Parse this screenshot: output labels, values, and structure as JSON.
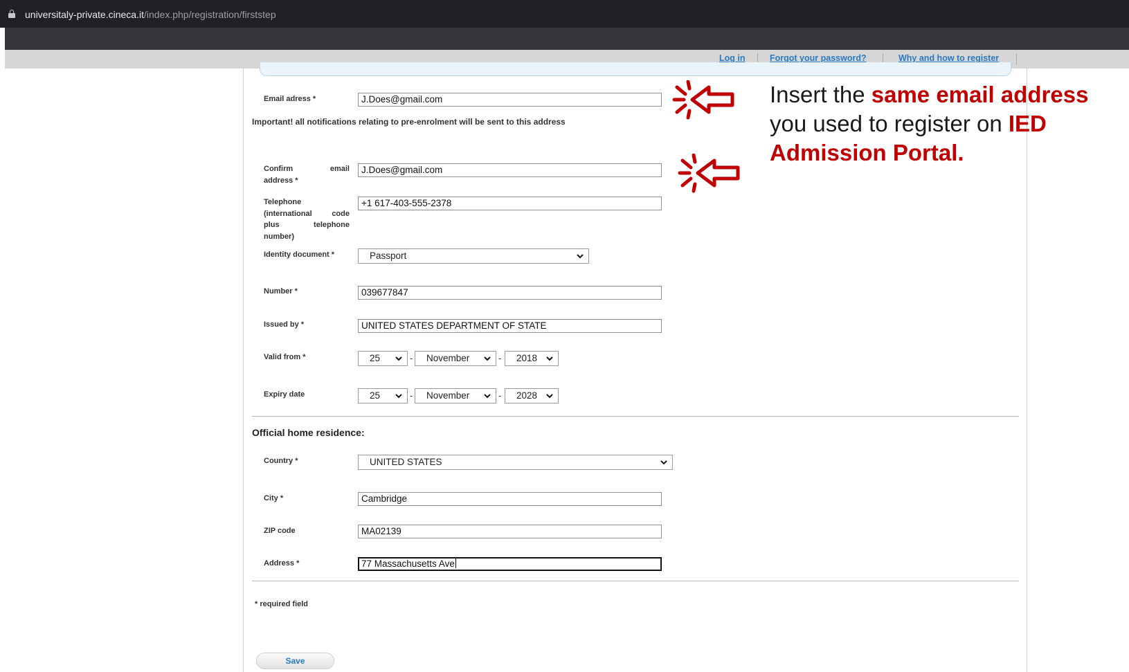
{
  "browser": {
    "url_domain": "universitaly-private.cineca.it",
    "url_path": "/index.php/registration/firststep"
  },
  "topnav": {
    "login": "Log in",
    "forgot_password": "Forgot your password?",
    "why_register": "Why and how to register"
  },
  "form": {
    "email": {
      "label": "Email adress *",
      "value": "J.Does@gmail.com"
    },
    "important_note": "Important! all notifications relating to pre-enrolment will be sent to this address",
    "confirm_email": {
      "label_line1": "Confirm email",
      "label_line2": "address *",
      "value": "J.Does@gmail.com"
    },
    "telephone": {
      "label_line1": "Telephone",
      "label_line2": "(international code",
      "label_line3": "plus telephone",
      "label_line4": "number)",
      "value": "+1 617-403-555-2378"
    },
    "identity_document": {
      "label": "Identity document *",
      "value": "Passport"
    },
    "number": {
      "label": "Number *",
      "value": "039677847"
    },
    "issued_by": {
      "label": "Issued by *",
      "value": "UNITED STATES DEPARTMENT OF STATE"
    },
    "valid_from": {
      "label": "Valid from *",
      "day": "25",
      "month": "November",
      "year": "2018"
    },
    "expiry_date": {
      "label": "Expiry date",
      "day": "25",
      "month": "November",
      "year": "2028"
    },
    "date_separator": "-"
  },
  "residence": {
    "title": "Official home residence:",
    "country": {
      "label": "Country *",
      "value": "UNITED STATES"
    },
    "city": {
      "label": "City *",
      "value": "Cambridge"
    },
    "zip": {
      "label": "ZIP code",
      "value": "MA02139"
    },
    "address": {
      "label": "Address *",
      "value": "77 Massachusetts Ave"
    }
  },
  "footer": {
    "required_note": "* required field",
    "save_label": "Save"
  },
  "annotation": {
    "text_1": "Insert the ",
    "text_2": "same email address",
    "text_3": " you used to register on ",
    "text_4": "IED Admission Portal.",
    "accent_color": "#c00000"
  }
}
